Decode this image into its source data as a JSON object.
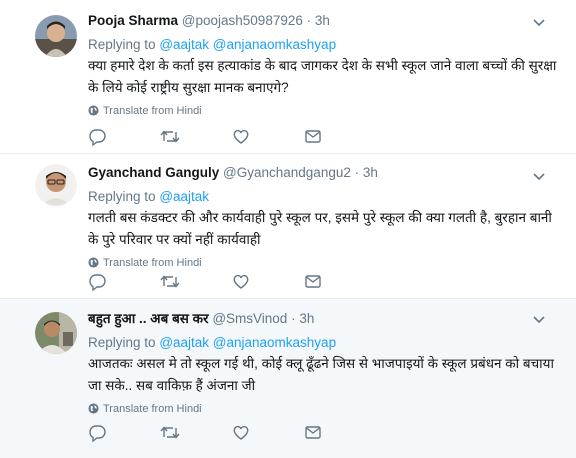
{
  "tweets": [
    {
      "name": "Pooja Sharma",
      "handle": "@poojash50987926",
      "dot": "·",
      "time": "3h",
      "replying_prefix": "Replying to",
      "replying_to": "@aajtak @anjanaomkashyap",
      "text": "क्या हमारे देश के कर्ता इस हत्याकांड के बाद जागकर देश के सभी  स्कूल जाने वाला बच्चों की सुरक्षा के लिये कोई  राष्ट्रीय सुरक्षा मानक बनाएगे?",
      "translate": "Translate from Hindi"
    },
    {
      "name": "Gyanchand Ganguly",
      "handle": "@Gyanchandgangu2",
      "dot": "·",
      "time": "3h",
      "replying_prefix": "Replying to",
      "replying_to": "@aajtak",
      "text": "गलती बस कंडक्टर की और कार्यवाही पुरे स्कूल पर, इसमे पुरे स्कूल की क्या गलती है, बुरहान बानी के पुरे परिवार पर क्यों नहीं कार्यवाही",
      "translate": "Translate from Hindi"
    },
    {
      "name": "बहुत हुआ .. अब बस कर",
      "handle": "@SmsVinod",
      "dot": "·",
      "time": "3h",
      "replying_prefix": "Replying to",
      "replying_to": "@aajtak @anjanaomkashyap",
      "text": "आजतकः असल मे तो स्कूल गई थी, कोई क्लू ढूँढने जिस से भाजपाइयों के स्कूल प्रबंधन को बचाया जा सके.. सब वाकिफ़ हैं अंजना जी",
      "translate": "Translate from Hindi"
    }
  ],
  "icons": {
    "reply": "reply-icon",
    "retweet": "retweet-icon",
    "like": "heart-icon",
    "dm": "envelope-icon",
    "more": "chevron-down-icon",
    "translate": "globe-icon"
  },
  "colors": {
    "link": "#1da1f2",
    "secondary": "#657786",
    "icon": "#657786",
    "shaded_bg": "#f5f8fa"
  }
}
